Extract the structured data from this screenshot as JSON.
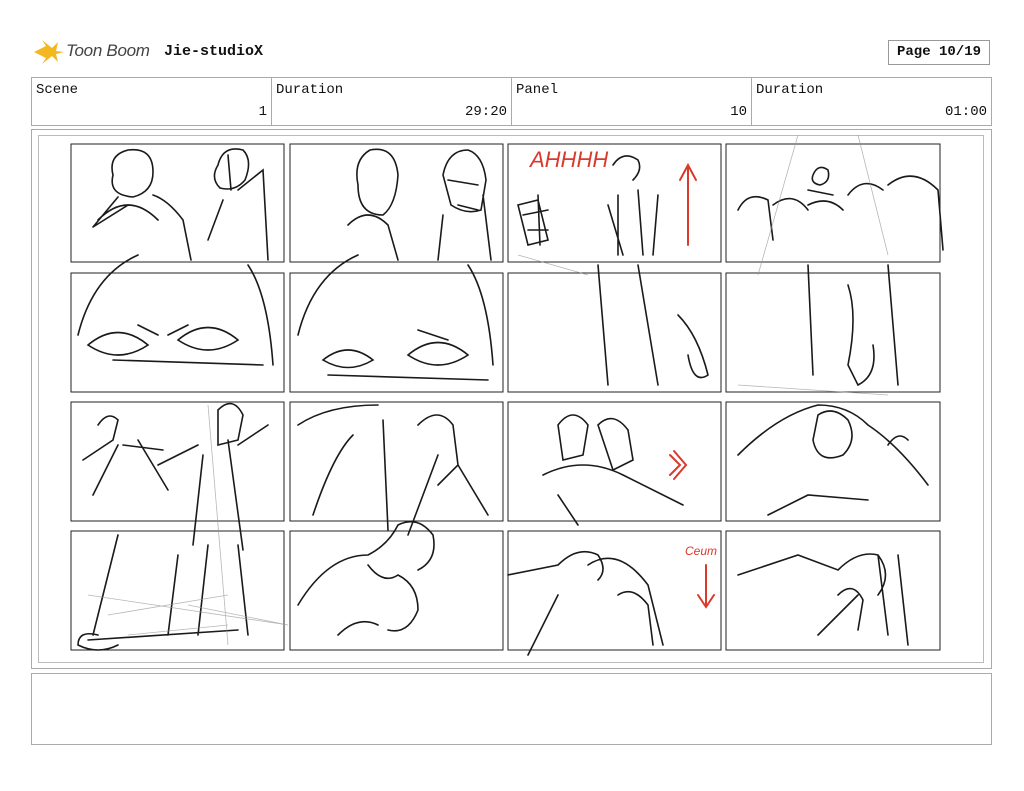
{
  "header": {
    "brand": "Toon Boom",
    "studio": "Jie-studioX",
    "page": "Page 10/19"
  },
  "fields": [
    {
      "label": "Scene",
      "value": "1"
    },
    {
      "label": "Duration",
      "value": "29:20"
    },
    {
      "label": "Panel",
      "value": "10"
    },
    {
      "label": "Duration",
      "value": "01:00"
    }
  ],
  "annotations": {
    "scream": "AHHHH",
    "sound": "Ceum"
  },
  "icons": [
    "toon-boom-logo-icon"
  ],
  "colors": {
    "accent_red": "#d93a2b",
    "logo_yellow": "#f3b81f"
  }
}
